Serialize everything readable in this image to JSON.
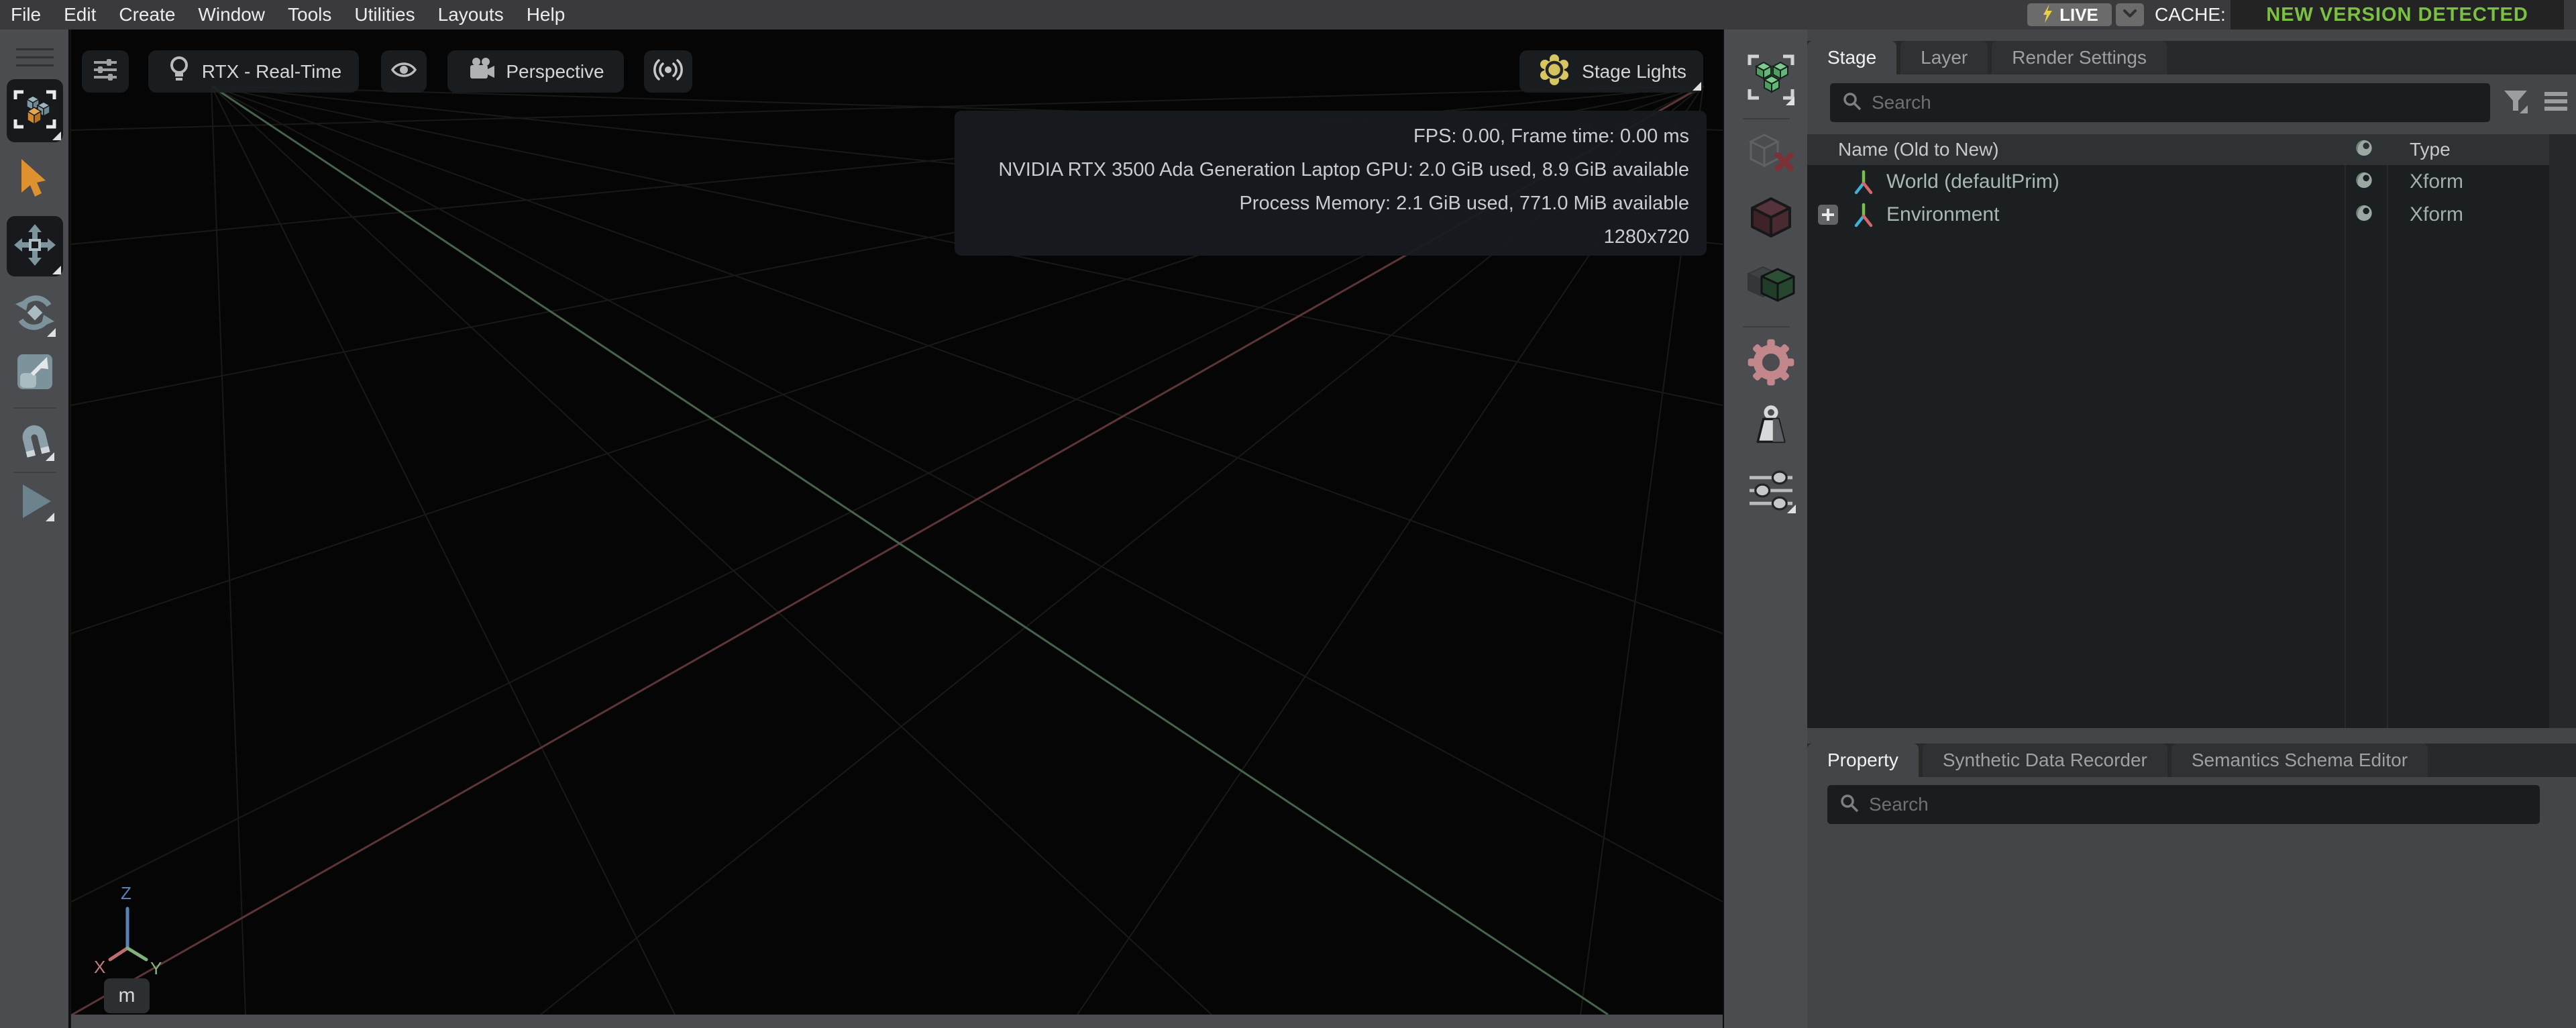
{
  "menubar": {
    "items": [
      "File",
      "Edit",
      "Create",
      "Window",
      "Tools",
      "Utilities",
      "Layouts",
      "Help"
    ],
    "live_label": "LIVE",
    "cache_label": "CACHE:",
    "version_notice": "NEW VERSION DETECTED",
    "colors": {
      "version_green": "#7ac142",
      "live_bolt": "#e8d23f"
    }
  },
  "left_toolbar": {
    "tools": [
      "select-box",
      "select",
      "move",
      "rotate",
      "scale",
      "snap",
      "play"
    ]
  },
  "physics_toolbar": {
    "tools": [
      "selection-set",
      "collider-remove",
      "static-collider",
      "dynamic-collider",
      "physics-settings",
      "mass",
      "physics-options"
    ]
  },
  "viewport": {
    "render_mode": "RTX - Real-Time",
    "camera": "Perspective",
    "stage_lights_label": "Stage Lights",
    "stats": [
      "FPS: 0.00, Frame time: 0.00 ms",
      "NVIDIA RTX 3500 Ada Generation Laptop GPU: 2.0 GiB used, 8.9 GiB available",
      "Process Memory: 2.1 GiB used, 771.0 MiB available",
      "1280x720"
    ],
    "axis_gizmo": {
      "x_label": "X",
      "y_label": "Y",
      "z_label": "Z",
      "unit_label": "m"
    },
    "colors": {
      "background": "#050505",
      "grid_line": "#171a17",
      "x_axis": "#5e3537",
      "y_axis": "#47634c"
    }
  },
  "stage_panel": {
    "tabs": [
      {
        "label": "Stage",
        "active": true
      },
      {
        "label": "Layer",
        "active": false
      },
      {
        "label": "Render Settings",
        "active": false
      }
    ],
    "search_placeholder": "Search",
    "tree": {
      "name_header": "Name (Old to New)",
      "type_header": "Type",
      "rows": [
        {
          "name": "World (defaultPrim)",
          "type": "Xform",
          "expandable": false
        },
        {
          "name": "Environment",
          "type": "Xform",
          "expandable": true
        }
      ]
    }
  },
  "property_panel": {
    "tabs": [
      {
        "label": "Property",
        "active": true
      },
      {
        "label": "Synthetic Data Recorder",
        "active": false
      },
      {
        "label": "Semantics Schema Editor",
        "active": false
      }
    ],
    "search_placeholder": "Search"
  }
}
